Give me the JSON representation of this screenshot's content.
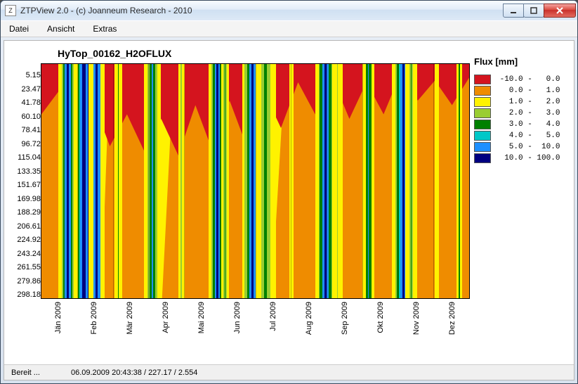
{
  "window": {
    "title": "ZTPView 2.0 - (c) Joanneum Research - 2010",
    "app_icon": "Z"
  },
  "menu": {
    "items": [
      "Datei",
      "Ansicht",
      "Extras"
    ]
  },
  "status": {
    "ready": "Bereit ...",
    "info": "06.09.2009 20:43:38 / 227.17 / 2.554"
  },
  "chart_data": {
    "type": "heatmap",
    "title": "HyTop_00162_H2OFLUX",
    "xlabel": "",
    "ylabel": "",
    "x_categories": [
      "Jän 2009",
      "Feb 2009",
      "Mär 2009",
      "Apr 2009",
      "Mai 2009",
      "Jun 2009",
      "Jul 2009",
      "Aug 2009",
      "Sep 2009",
      "Okt 2009",
      "Nov 2009",
      "Dez 2009"
    ],
    "y_ticks": [
      5.15,
      23.47,
      41.78,
      60.1,
      78.41,
      96.72,
      115.04,
      133.35,
      151.67,
      169.98,
      188.29,
      206.61,
      224.92,
      243.24,
      261.55,
      279.86,
      298.18
    ],
    "ylim": [
      298.18,
      5.15
    ],
    "legend_title": "Flux [mm]",
    "legend": [
      {
        "color": "#d4141e",
        "label": " -10.0 -   0.0",
        "range": [
          -10.0,
          0.0
        ]
      },
      {
        "color": "#ef8c00",
        "label": "   0.0 -   1.0",
        "range": [
          0.0,
          1.0
        ]
      },
      {
        "color": "#fff200",
        "label": "   1.0 -   2.0",
        "range": [
          1.0,
          2.0
        ]
      },
      {
        "color": "#9acd32",
        "label": "   2.0 -   3.0",
        "range": [
          2.0,
          3.0
        ]
      },
      {
        "color": "#008000",
        "label": "   3.0 -   4.0",
        "range": [
          3.0,
          4.0
        ]
      },
      {
        "color": "#00c8c8",
        "label": "   4.0 -   5.0",
        "range": [
          4.0,
          5.0
        ]
      },
      {
        "color": "#1e90ff",
        "label": "   5.0 -  10.0",
        "range": [
          5.0,
          10.0
        ]
      },
      {
        "color": "#000080",
        "label": "  10.0 - 100.0",
        "range": [
          10.0,
          100.0
        ]
      }
    ],
    "events": [
      {
        "pos_pct": 4,
        "bands": [
          [
            "#fff200",
            3
          ],
          [
            "#9acd32",
            1
          ],
          [
            "#008000",
            1
          ],
          [
            "#1e90ff",
            2
          ],
          [
            "#000080",
            2
          ]
        ]
      },
      {
        "pos_pct": 8,
        "bands": [
          [
            "#fff200",
            2
          ],
          [
            "#008000",
            1
          ],
          [
            "#00c8c8",
            1
          ],
          [
            "#1e90ff",
            2
          ],
          [
            "#000080",
            3
          ],
          [
            "#1e90ff",
            2
          ]
        ]
      },
      {
        "pos_pct": 11,
        "bands": [
          [
            "#fff200",
            4
          ],
          [
            "#1e90ff",
            2
          ],
          [
            "#000080",
            2
          ]
        ]
      },
      {
        "pos_pct": 17,
        "bands": [
          [
            "#fff200",
            3
          ],
          [
            "#008000",
            1
          ]
        ]
      },
      {
        "pos_pct": 24,
        "bands": [
          [
            "#fff200",
            3
          ],
          [
            "#9acd32",
            2
          ],
          [
            "#008000",
            2
          ],
          [
            "#1e90ff",
            1
          ]
        ]
      },
      {
        "pos_pct": 32,
        "bands": [
          [
            "#fff200",
            2
          ],
          [
            "#9acd32",
            1
          ]
        ]
      },
      {
        "pos_pct": 39,
        "bands": [
          [
            "#fff200",
            3
          ],
          [
            "#9acd32",
            1
          ],
          [
            "#008000",
            2
          ],
          [
            "#1e90ff",
            1
          ],
          [
            "#000080",
            2
          ]
        ]
      },
      {
        "pos_pct": 42,
        "bands": [
          [
            "#fff200",
            2
          ],
          [
            "#9acd32",
            1
          ],
          [
            "#008000",
            1
          ]
        ]
      },
      {
        "pos_pct": 47,
        "bands": [
          [
            "#fff200",
            2
          ],
          [
            "#9acd32",
            2
          ],
          [
            "#008000",
            2
          ],
          [
            "#1e90ff",
            2
          ],
          [
            "#000080",
            2
          ]
        ]
      },
      {
        "pos_pct": 50,
        "bands": [
          [
            "#fff200",
            5
          ],
          [
            "#9acd32",
            3
          ],
          [
            "#008000",
            2
          ]
        ]
      },
      {
        "pos_pct": 58,
        "bands": [
          [
            "#fff200",
            2
          ]
        ]
      },
      {
        "pos_pct": 64,
        "bands": [
          [
            "#fff200",
            3
          ],
          [
            "#9acd32",
            1
          ],
          [
            "#008000",
            2
          ],
          [
            "#1e90ff",
            2
          ],
          [
            "#000080",
            2
          ]
        ]
      },
      {
        "pos_pct": 68,
        "bands": [
          [
            "#fff200",
            4
          ],
          [
            "#9acd32",
            1
          ]
        ]
      },
      {
        "pos_pct": 75,
        "bands": [
          [
            "#fff200",
            3
          ],
          [
            "#008000",
            2
          ],
          [
            "#1e90ff",
            1
          ]
        ]
      },
      {
        "pos_pct": 82,
        "bands": [
          [
            "#fff200",
            3
          ],
          [
            "#9acd32",
            1
          ],
          [
            "#008000",
            2
          ],
          [
            "#00c8c8",
            1
          ],
          [
            "#1e90ff",
            2
          ],
          [
            "#000080",
            2
          ]
        ]
      },
      {
        "pos_pct": 85,
        "bands": [
          [
            "#fff200",
            4
          ],
          [
            "#9acd32",
            1
          ],
          [
            "#008000",
            1
          ]
        ]
      },
      {
        "pos_pct": 92,
        "bands": [
          [
            "#fff200",
            2
          ]
        ]
      },
      {
        "pos_pct": 97,
        "bands": [
          [
            "#fff200",
            2
          ],
          [
            "#008000",
            1
          ]
        ]
      }
    ],
    "yellow_wedges": [
      {
        "left_pct": 11,
        "width_pct": 5
      },
      {
        "left_pct": 24,
        "width_pct": 7
      },
      {
        "left_pct": 39,
        "width_pct": 5
      },
      {
        "left_pct": 49,
        "width_pct": 8
      },
      {
        "left_pct": 64,
        "width_pct": 6
      },
      {
        "left_pct": 82,
        "width_pct": 6
      }
    ]
  }
}
